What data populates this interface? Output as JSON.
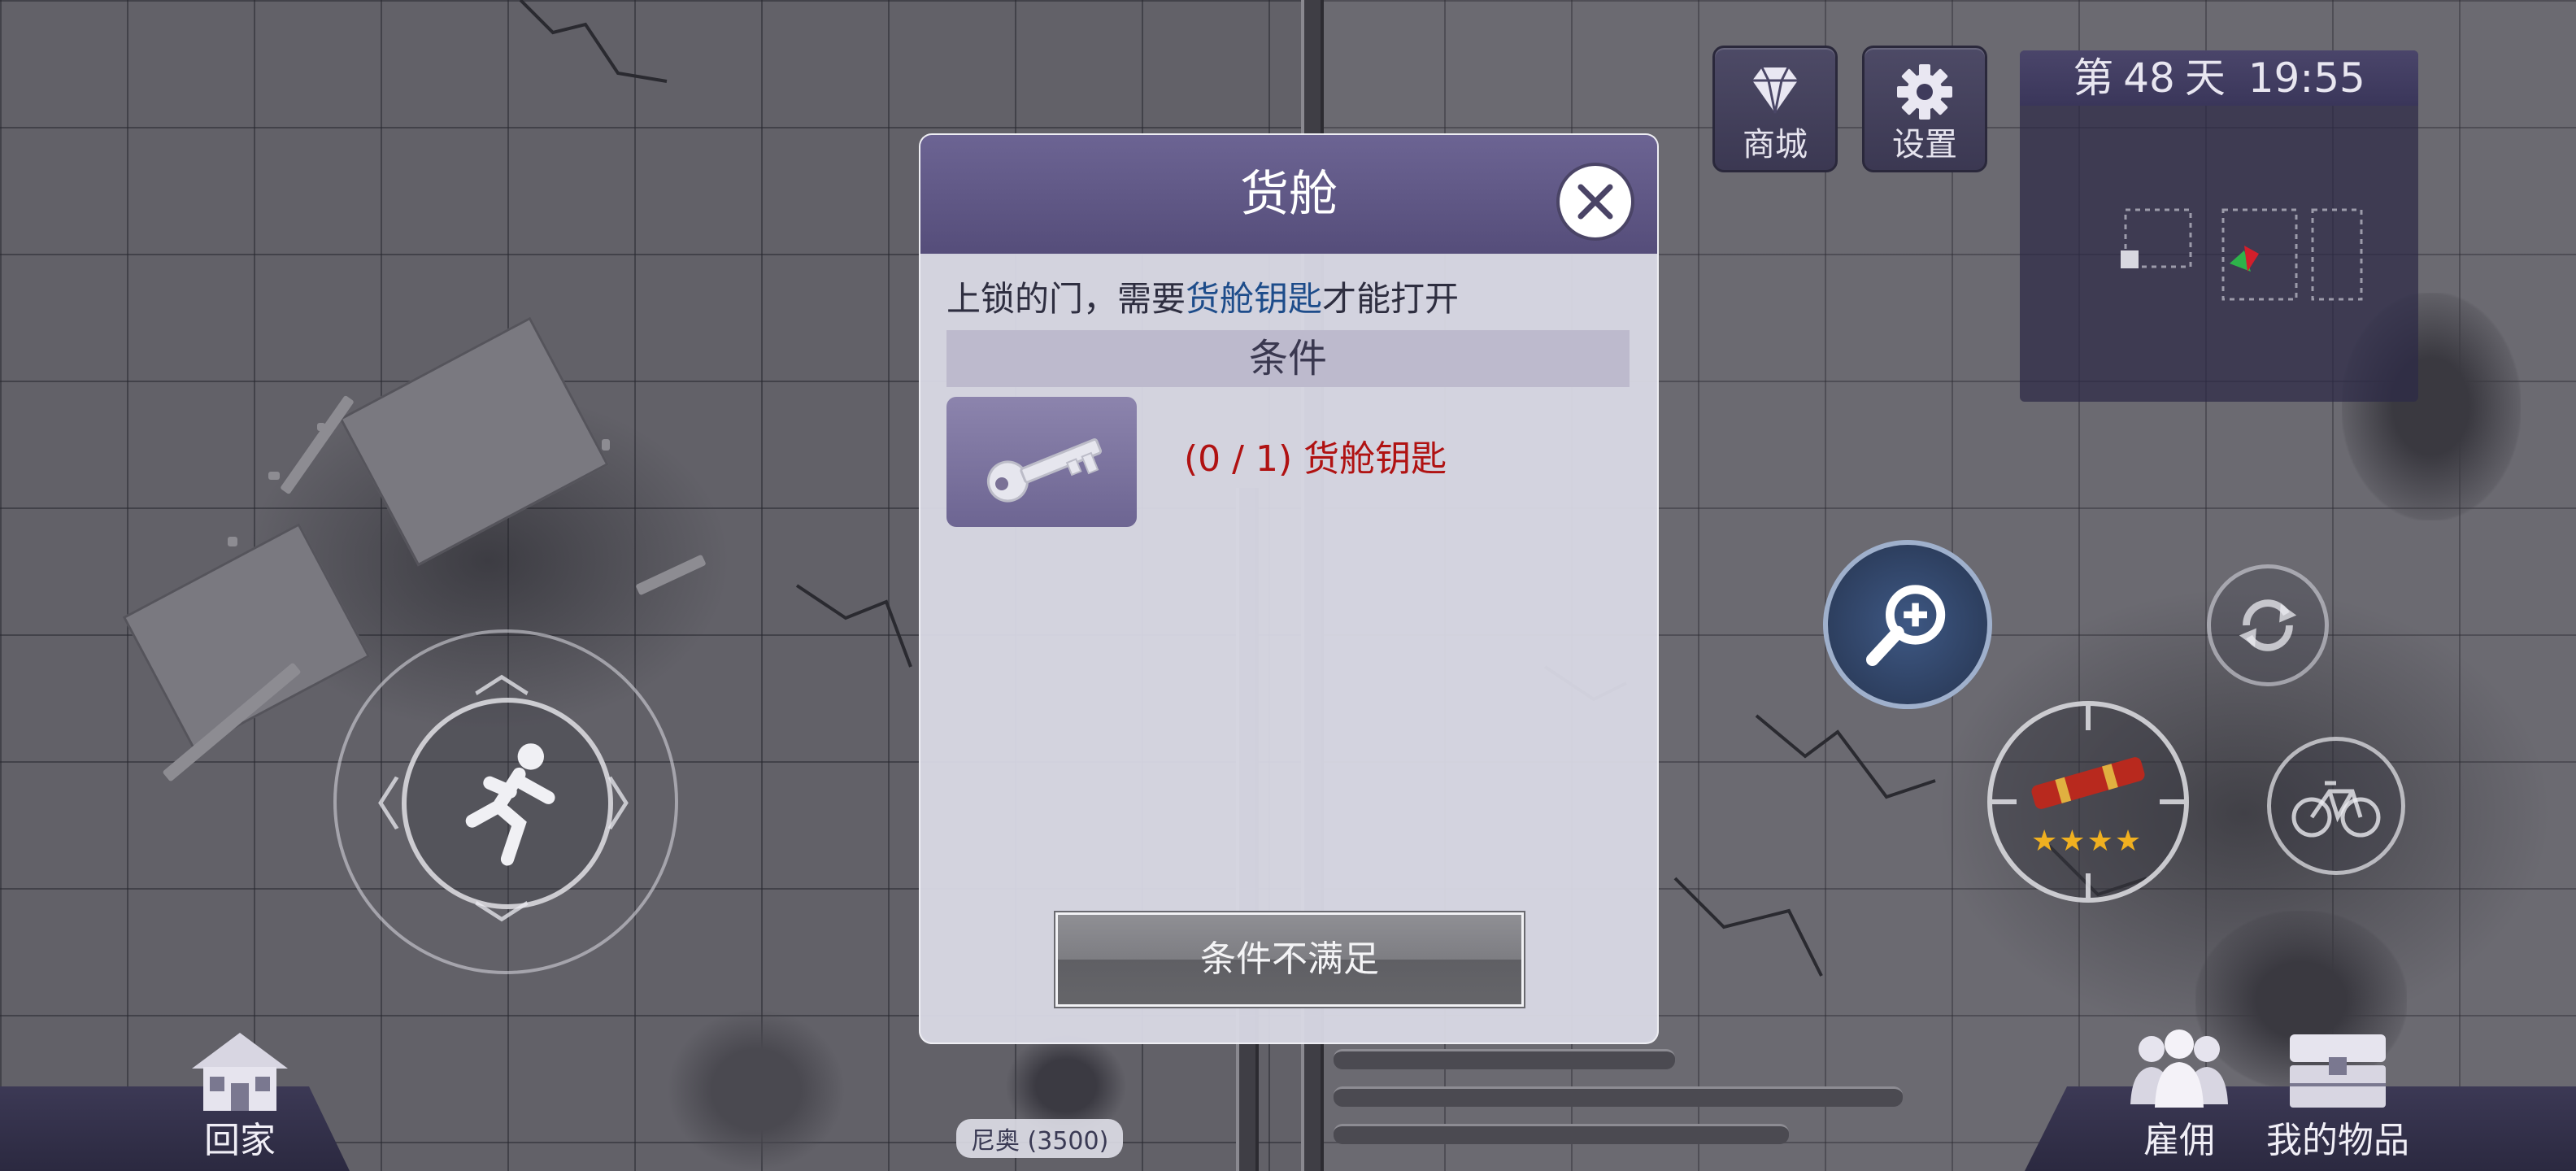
{
  "hud": {
    "day_prefix": "第",
    "day_number": "48",
    "day_suffix": "天",
    "time": "19:55",
    "shop_label": "商城",
    "settings_label": "设置"
  },
  "dialog": {
    "title": "货舱",
    "description_prefix": "上锁的门，需要",
    "description_highlight": "货舱钥匙",
    "description_suffix": "才能打开",
    "conditions_header": "条件",
    "requirement_text": "(0 / 1) 货舱钥匙",
    "requirement_color": "#b01212",
    "confirm_button": "条件不满足"
  },
  "bottom_bar": {
    "home_label": "回家",
    "hire_label": "雇佣",
    "items_label": "我的物品"
  },
  "npc": {
    "name_tag": "尼奥 (3500)"
  },
  "weapon": {
    "stars": 4
  },
  "colors": {
    "dialog_header": "#5e5685",
    "highlight_text": "#1d4c8a",
    "hud_panel": "#3f3b5c"
  }
}
